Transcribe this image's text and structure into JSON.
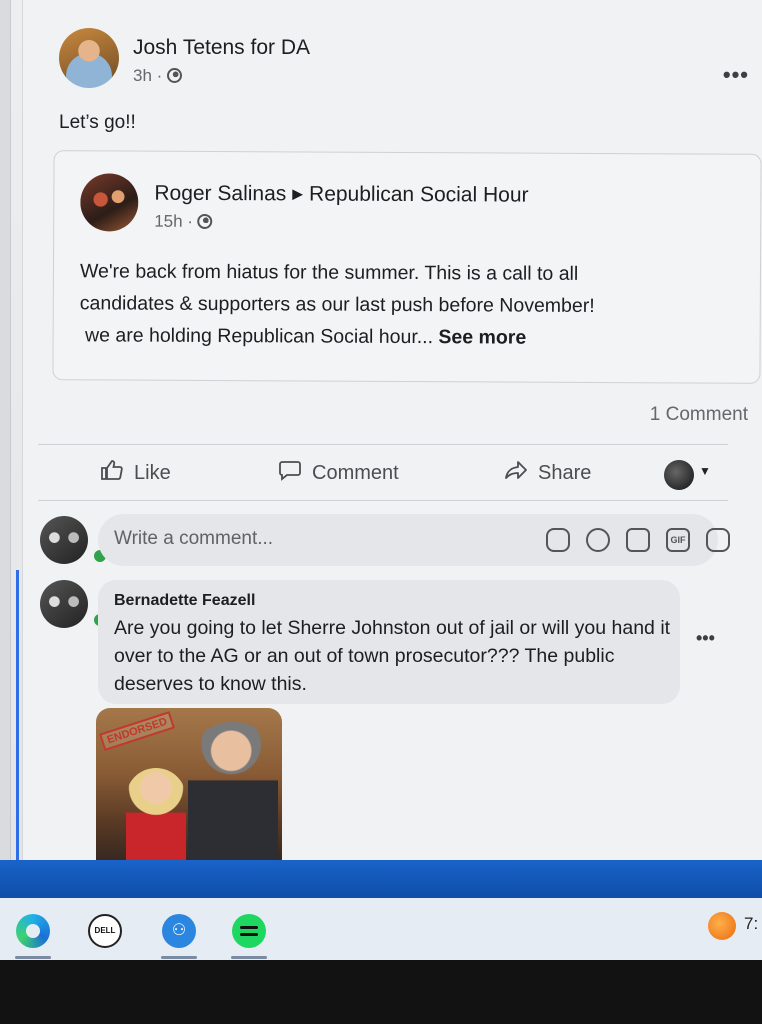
{
  "post": {
    "author": "Josh Tetens for DA",
    "time": "3h ·",
    "menu": "•••",
    "text": "Let’s go!!"
  },
  "shared_post": {
    "author": "Roger Salinas",
    "group": "Republican Social Hour",
    "time": "15h ·",
    "body_lines": [
      "We're back from hiatus for the summer.  This is a call to all",
      "candidates & supporters as our last push before November!",
      "we are holding Republican Social hour..."
    ],
    "see_more": "See more"
  },
  "stats": {
    "comment_count": "1 Comment"
  },
  "actions": {
    "like": "Like",
    "comment": "Comment",
    "share": "Share"
  },
  "composer": {
    "placeholder": "Write a comment...",
    "icons": [
      "sticker-icon",
      "emoji-icon",
      "camera-icon",
      "gif-icon",
      "avatar-sticker-icon"
    ],
    "gif_label": "GIF"
  },
  "comment": {
    "author": "Bernadette Feazell",
    "text": "Are you going to let Sherre Johnston out of jail or will you hand it over to the AG or an out of town prosecutor??? The public deserves to know this.",
    "menu": "•••",
    "image_stamp": "ENDORSED"
  },
  "taskbar": {
    "apps": [
      "edge-icon",
      "dell-icon",
      "people-icon",
      "spotify-icon"
    ],
    "dell_label": "DELL",
    "tray_text": "7:"
  },
  "colors": {
    "accent_blue": "#1a63c9",
    "online_green": "#31a24c",
    "thread_line": "#2f6ee6"
  }
}
